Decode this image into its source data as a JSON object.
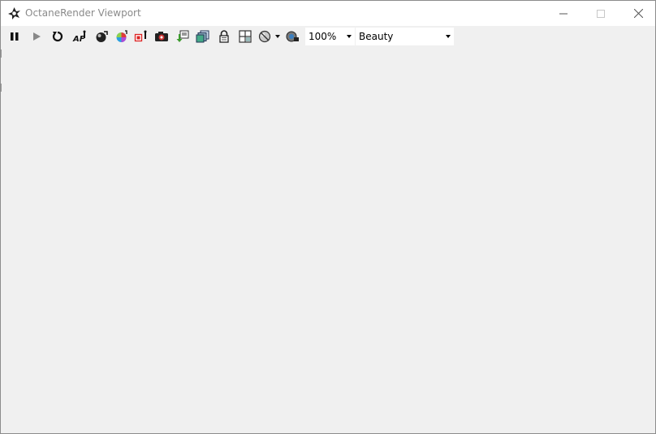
{
  "window": {
    "title": "OctaneRender Viewport",
    "controls": [
      "minimize",
      "maximize",
      "close"
    ]
  },
  "toolbar": {
    "buttons": [
      {
        "name": "pause-icon"
      },
      {
        "name": "play-icon"
      },
      {
        "name": "restart-icon"
      },
      {
        "name": "autofocus-icon"
      },
      {
        "name": "render-region-icon"
      },
      {
        "name": "color-picker-icon"
      },
      {
        "name": "material-picker-icon"
      },
      {
        "name": "camera-icon"
      },
      {
        "name": "export-icon"
      },
      {
        "name": "copy-layers-icon"
      },
      {
        "name": "lock-icon"
      },
      {
        "name": "layout-grid-icon"
      },
      {
        "name": "clay-mode-icon"
      },
      {
        "name": "sync-camera-icon"
      }
    ],
    "zoom": {
      "value": "100%"
    },
    "render_pass": {
      "value": "Beauty"
    }
  }
}
